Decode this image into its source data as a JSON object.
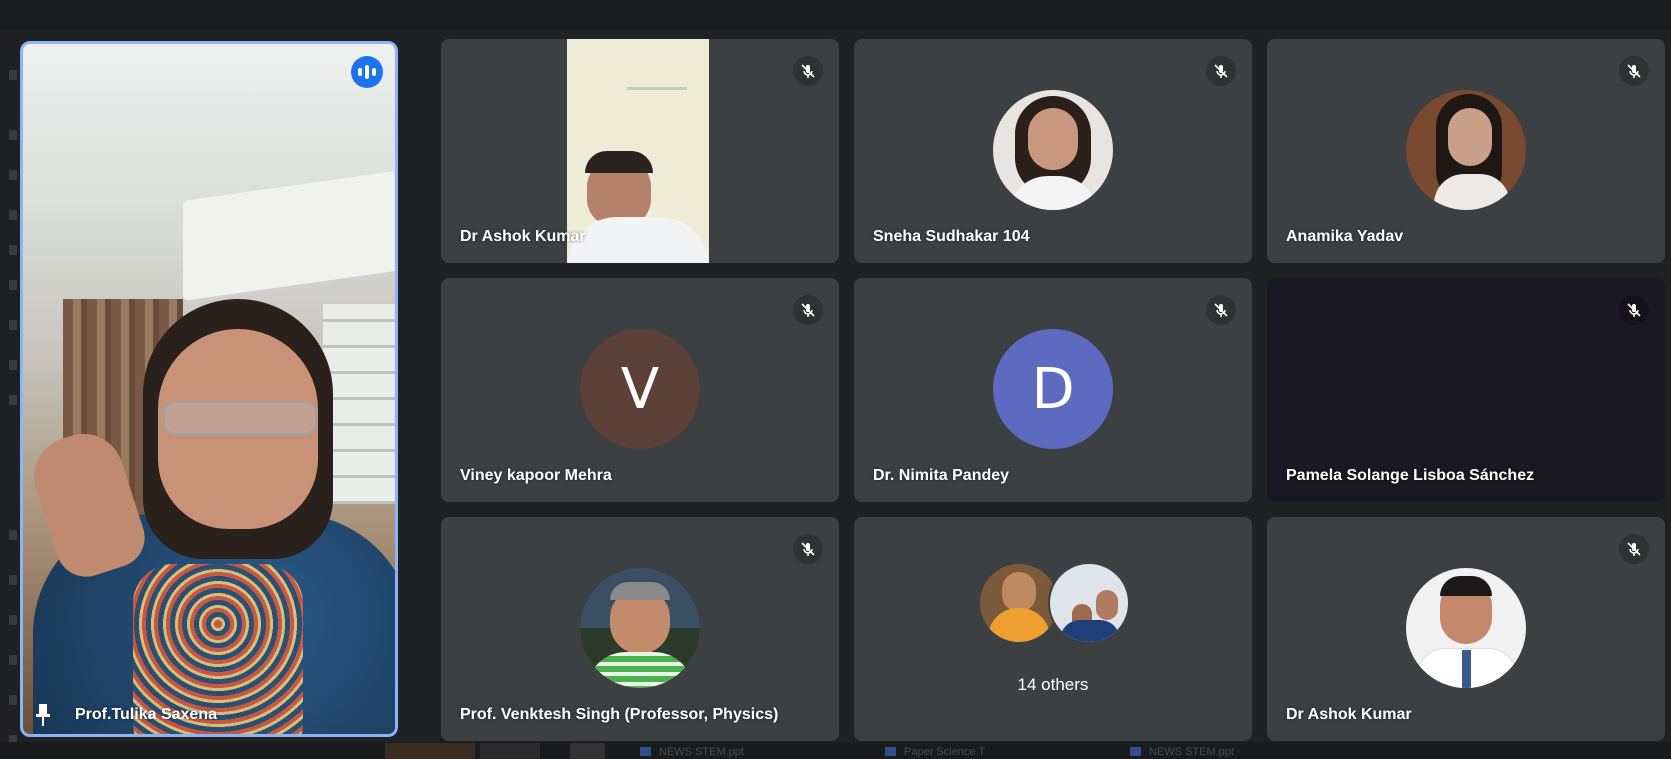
{
  "meeting": {
    "pinned": {
      "name": "Prof.Tulika Saxena",
      "speaking": true,
      "pinned": true
    },
    "tiles": [
      {
        "name": "Dr Ashok Kumar",
        "type": "video",
        "muted": true
      },
      {
        "name": "Sneha Sudhakar 104",
        "type": "photo",
        "muted": true
      },
      {
        "name": "Anamika Yadav",
        "type": "photo",
        "muted": true
      },
      {
        "name": "Viney kapoor Mehra",
        "type": "initial",
        "initial": "V",
        "color": "#5d4037",
        "muted": true
      },
      {
        "name": "Dr. Nimita Pandey",
        "type": "initial",
        "initial": "D",
        "color": "#5c6bc0",
        "muted": true
      },
      {
        "name": "Pamela Solange Lisboa Sánchez",
        "type": "dark",
        "muted": true
      },
      {
        "name": "Prof. Venktesh Singh (Professor, Physics)",
        "type": "photo",
        "muted": true
      },
      {
        "label": "14 others",
        "type": "group"
      },
      {
        "name": "Dr Ashok Kumar",
        "type": "photo",
        "muted": true
      }
    ]
  },
  "colors": {
    "accent": "#8ab4f8",
    "speaking": "#1a73e8",
    "tile": "#3c4043",
    "background": "#202124"
  }
}
